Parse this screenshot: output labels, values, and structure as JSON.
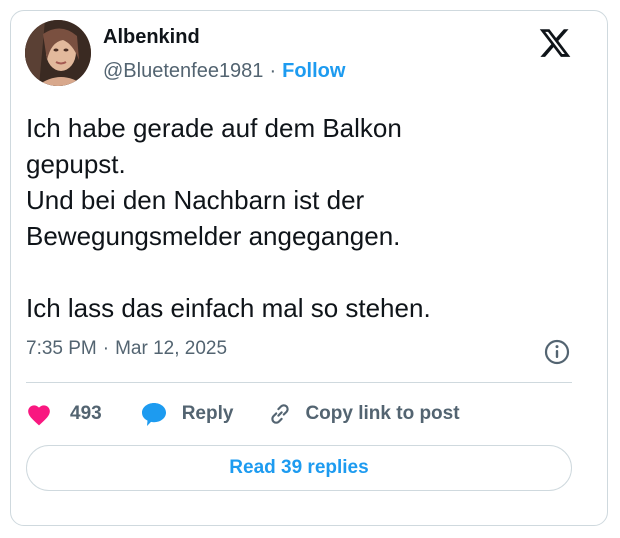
{
  "author": {
    "name": "Albenkind",
    "handle": "@Bluetenfee1981",
    "separator": "·",
    "follow_label": "Follow",
    "avatar_icon": "profile-photo"
  },
  "brand": {
    "logo": "x-logo",
    "color": "#0f1419"
  },
  "tweet": {
    "lines": [
      "Ich habe gerade auf dem Balkon",
      "gepupst.",
      "Und bei den Nachbarn ist der",
      "Bewegungsmelder angegangen.",
      "",
      "Ich lass das einfach mal so stehen."
    ]
  },
  "meta": {
    "time": "7:35 PM",
    "separator": "·",
    "date": "Mar 12, 2025",
    "info_icon": "info-icon"
  },
  "actions": {
    "like_count": "493",
    "like_icon": "heart-icon",
    "reply_label": "Reply",
    "reply_icon": "speech-bubble-icon",
    "copy_label": "Copy link to post",
    "copy_icon": "link-icon"
  },
  "footer": {
    "read_replies_label": "Read 39 replies"
  },
  "colors": {
    "accent": "#1d9bf0",
    "like": "#f91880",
    "muted": "#536471",
    "border": "#cfd9de"
  }
}
